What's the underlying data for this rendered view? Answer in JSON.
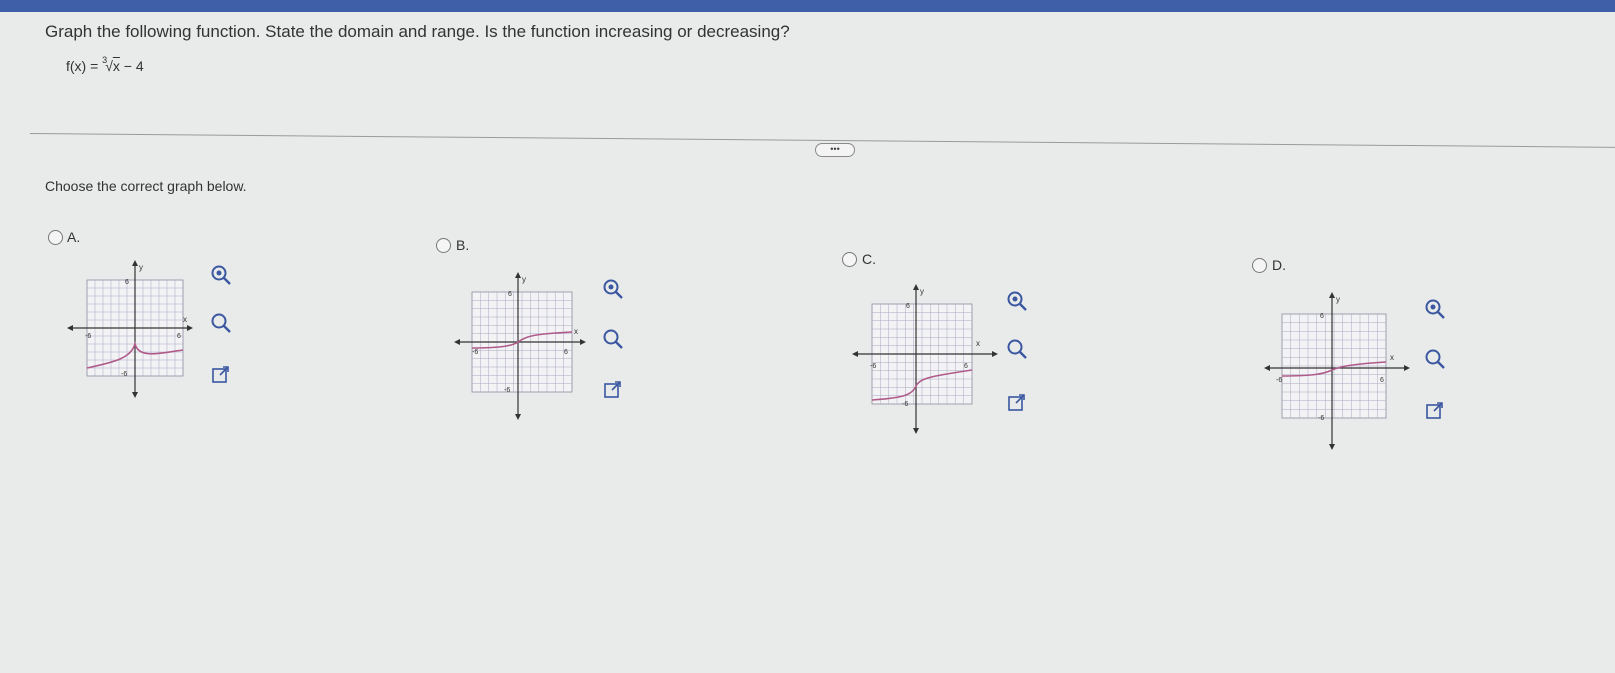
{
  "question": {
    "text": "Graph the following function. State the domain and range. Is the function increasing or decreasing?",
    "function_lhs": "f(x) = ",
    "root_index": "3",
    "radicand": "x",
    "function_rest": " − 4"
  },
  "more_button": "•••",
  "prompt": "Choose the correct graph below.",
  "options": [
    {
      "label": "A.",
      "ytick": "6",
      "xneg": "-6",
      "xpos": "6",
      "ybot": "-6",
      "xlabel": "x",
      "ylabel": "y"
    },
    {
      "label": "B.",
      "ytick": "6",
      "xneg": "-6",
      "xpos": "6",
      "ybot": "-6",
      "xlabel": "x",
      "ylabel": "y"
    },
    {
      "label": "C.",
      "ytick": "6",
      "xneg": "-6",
      "xpos": "6",
      "ybot": "-6",
      "xlabel": "x",
      "ylabel": "y"
    },
    {
      "label": "D.",
      "ytick": "6",
      "xneg": "-6",
      "xpos": "6",
      "ybot": "-6",
      "xlabel": "x",
      "ylabel": "y"
    }
  ],
  "tools": {
    "zoom_in": "zoom-in-icon",
    "zoom_out": "zoom-out-icon",
    "popout": "popout-icon"
  }
}
